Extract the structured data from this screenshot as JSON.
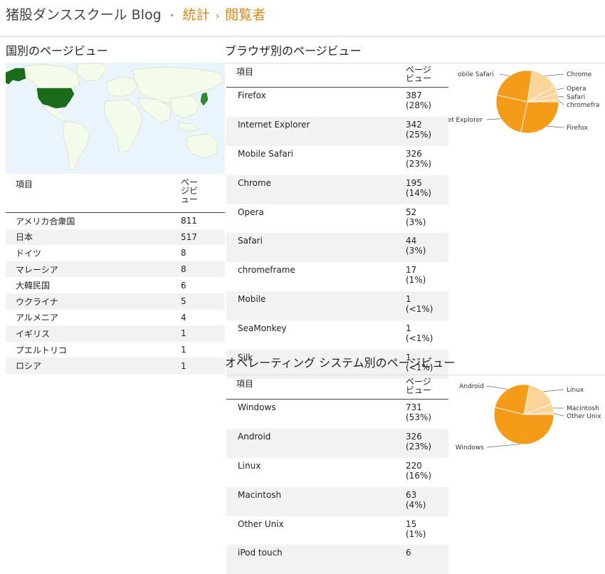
{
  "breadcrumb": {
    "blog": "猪股ダンススクール Blog",
    "sep1": "・",
    "stats": "統計",
    "sep2": "›",
    "viewers": "閲覧者"
  },
  "country_section": {
    "title": "国別のページビュー",
    "col_item": "項目",
    "col_pv": "ページビュー",
    "rows": [
      {
        "name": "アメリカ合衆国",
        "value": "811"
      },
      {
        "name": "日本",
        "value": "517"
      },
      {
        "name": "ドイツ",
        "value": "8"
      },
      {
        "name": "マレーシア",
        "value": "8"
      },
      {
        "name": "大韓民国",
        "value": "6"
      },
      {
        "name": "ウクライナ",
        "value": "5"
      },
      {
        "name": "アルメニア",
        "value": "4"
      },
      {
        "name": "イギリス",
        "value": "1"
      },
      {
        "name": "プエルトリコ",
        "value": "1"
      },
      {
        "name": "ロシア",
        "value": "1"
      }
    ]
  },
  "browser_section": {
    "title": "ブラウザ別のページビュー",
    "col_item": "項目",
    "col_pv": "ページビュー",
    "rows": [
      {
        "name": "Firefox",
        "value": "387",
        "pct": "(28%)"
      },
      {
        "name": "Internet Explorer",
        "value": "342",
        "pct": "(25%)"
      },
      {
        "name": "Mobile Safari",
        "value": "326",
        "pct": "(23%)"
      },
      {
        "name": "Chrome",
        "value": "195",
        "pct": "(14%)"
      },
      {
        "name": "Opera",
        "value": "52",
        "pct": "(3%)"
      },
      {
        "name": "Safari",
        "value": "44",
        "pct": "(3%)"
      },
      {
        "name": "chromeframe",
        "value": "17",
        "pct": "(1%)"
      },
      {
        "name": "Mobile",
        "value": "1",
        "pct": "(<1%)"
      },
      {
        "name": "SeaMonkey",
        "value": "1",
        "pct": "(<1%)"
      },
      {
        "name": "Silk",
        "value": "1",
        "pct": "(<1%)"
      }
    ]
  },
  "os_section": {
    "title": "オペレーティング システム別のページビュー",
    "col_item": "項目",
    "col_pv": "ページビュー",
    "rows": [
      {
        "name": "Windows",
        "value": "731",
        "pct": "(53%)"
      },
      {
        "name": "Android",
        "value": "326",
        "pct": "(23%)"
      },
      {
        "name": "Linux",
        "value": "220",
        "pct": "(16%)"
      },
      {
        "name": "Macintosh",
        "value": "63",
        "pct": "(4%)"
      },
      {
        "name": "Other Unix",
        "value": "15",
        "pct": "(1%)"
      },
      {
        "name": "iPod touch",
        "value": "6",
        "pct": ""
      }
    ]
  },
  "colors": {
    "accent": "#d48a1c",
    "usa": "#1a6b1a",
    "japan": "#2d8a2d",
    "map_land": "#f4fbe8",
    "map_water": "#eaf4fc",
    "pie_main": "#f59b1a",
    "pie_light": "#fbd49a"
  },
  "chart_data": [
    {
      "type": "pie",
      "categories": [
        "Firefox",
        "Internet Explorer",
        "Mobile Safari",
        "Chrome",
        "Opera",
        "Safari",
        "chromeframe"
      ],
      "values": [
        387,
        342,
        326,
        195,
        52,
        44,
        17
      ],
      "labels": [
        "Firefox",
        "et Explorer",
        "obile Safari",
        "Chrome",
        "Opera",
        "Safari",
        "chromefra"
      ]
    },
    {
      "type": "pie",
      "categories": [
        "Windows",
        "Android",
        "Linux",
        "Macintosh",
        "Other Unix"
      ],
      "values": [
        731,
        326,
        220,
        63,
        15
      ],
      "labels": [
        "Windows",
        "Android",
        "Linux",
        "Macintosh",
        "Other Unix"
      ]
    }
  ]
}
